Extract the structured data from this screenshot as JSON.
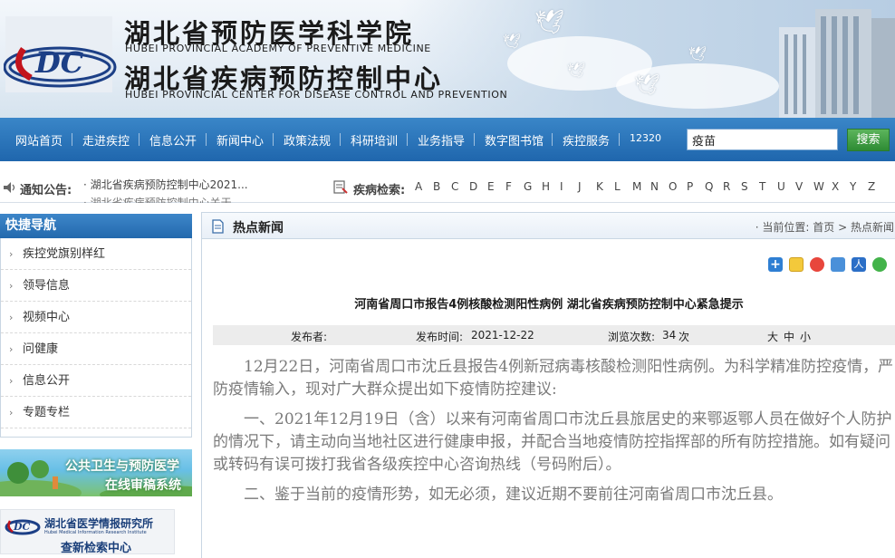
{
  "header": {
    "org_name_1_cn": "湖北省预防医学科学院",
    "org_name_1_en": "HUBEI PROVINCIAL ACADEMY OF PREVENTIVE MEDICINE",
    "org_name_2_cn": "湖北省疾病预防控制中心",
    "org_name_2_en": "HUBEI PROVINCIAL CENTER FOR DISEASE CONTROL AND PREVENTION",
    "logo_text": "CDC"
  },
  "nav": {
    "items": [
      "网站首页",
      "走进疾控",
      "信息公开",
      "新闻中心",
      "政策法规",
      "科研培训",
      "业务指导",
      "数字图书馆",
      "疾控服务",
      "12320"
    ],
    "search_value": "疫苗",
    "search_button": "搜索"
  },
  "notice": {
    "label": "通知公告:",
    "item_1": "· 湖北省疾病预防控制中心2021...",
    "item_2": "· 湖北省疾病预防控制中心关于...",
    "disease_search_label": "疾病检索:",
    "letters": [
      "A",
      "B",
      "C",
      "D",
      "E",
      "F",
      "G",
      "H",
      "I",
      "J",
      "K",
      "L",
      "M",
      "N",
      "O",
      "P",
      "Q",
      "R",
      "S",
      "T",
      "U",
      "V",
      "W",
      "X",
      "Y",
      "Z"
    ]
  },
  "sidebar": {
    "title": "快捷导航",
    "items": [
      "疾控党旗别样红",
      "领导信息",
      "视频中心",
      "问健康",
      "信息公开",
      "专题专栏"
    ],
    "promo_1_line1": "公共卫生与预防医学",
    "promo_1_line2": "在线审稿系统",
    "promo_2_line1": "湖北省医学情报研究所",
    "promo_2_line1_en": "Hubei Medical Information Research Institute",
    "promo_2_line2": "查新检索中心"
  },
  "main": {
    "section_title": "热点新闻",
    "breadcrumb_prefix": "· 当前位置:",
    "breadcrumb_home": "首页",
    "breadcrumb_sep": ">",
    "breadcrumb_current": "热点新闻",
    "article_title": "河南省周口市报告4例核酸检测阳性病例 湖北省疾病预防控制中心紧急提示",
    "meta": {
      "publisher_label": "发布者:",
      "time_label": "发布时间:",
      "time_value": "2021-12-22",
      "views_label": "浏览次数:",
      "views_value": "34",
      "views_unit": "次",
      "size_large": "大",
      "size_medium": "中",
      "size_small": "小"
    },
    "paragraphs": [
      "12月22日，河南省周口市沈丘县报告4例新冠病毒核酸检测阳性病例。为科学精准防控疫情，严防疫情输入，现对广大群众提出如下疫情防控建议:",
      "一、2021年12月19日（含）以来有河南省周口市沈丘县旅居史的来鄂返鄂人员在做好个人防护的情况下，请主动向当地社区进行健康申报，并配合当地疫情防控指挥部的所有防控措施。如有疑问或转码有误可拨打我省各级疾控中心咨询热线（号码附后）。",
      "二、鉴于当前的疫情形势，如无必须，建议近期不要前往河南省周口市沈丘县。"
    ]
  },
  "colors": {
    "nav_blue": "#1f66ad",
    "search_green": "#2e8b34",
    "body_text": "#7a7a7a"
  }
}
